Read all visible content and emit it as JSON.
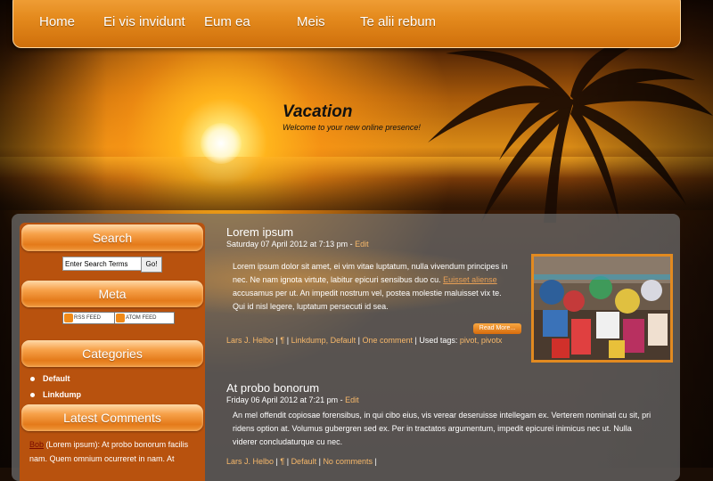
{
  "nav": {
    "items": [
      "Home",
      "Ei vis invidunt",
      "Eum ea",
      "Meis",
      "Te alii rebum"
    ]
  },
  "site": {
    "title": "Vacation",
    "tagline": "Welcome to your new online presence!"
  },
  "sidebar": {
    "search": {
      "heading": "Search",
      "input_value": "Enter Search Terms",
      "button_label": "Go!"
    },
    "meta": {
      "heading": "Meta",
      "rss_label": "RSS FEED",
      "atom_label": "ATOM FEED"
    },
    "categories": {
      "heading": "Categories",
      "items": [
        "Default",
        "Linkdump"
      ]
    },
    "latest_comments": {
      "heading": "Latest Comments",
      "author": "Bob",
      "text": "(Lorem ipsum): At probo bonorum facilis nam. Quem omnium ocurreret in nam. At"
    }
  },
  "posts": [
    {
      "title": "Lorem ipsum",
      "date": "Saturday 07 April 2012 at 7:13 pm",
      "edit_label": "Edit",
      "body_lines": [
        "Lorem ipsum dolor sit amet, ei vim vitae luptatum, nulla vivendum principes in",
        "nec. Ne nam ignota virtute, labitur epicuri sensibus duo cu.",
        "accusamus per ut. An impedit nostrum vel, postea molestie maluisset vix te.",
        "Qui id nisl legere, luptatum persecuti id sea."
      ],
      "inline_link": "Euisset aliense",
      "read_more": "Read More...",
      "author": "Lars J. Helbo",
      "pilcrow": "¶",
      "categories": "Linkdump, Default",
      "comments": "One comment",
      "tags_label": "Used tags:",
      "tags": "pivot, pivotx"
    },
    {
      "title": "At probo bonorum",
      "date": "Friday 06 April 2012 at 7:21 pm",
      "edit_label": "Edit",
      "body_lines": [
        "An mel offendit copiosae forensibus, in qui cibo eius, vis verear deseruisse intellegam ex. Verterem nominati cu sit, pri",
        "ridens option at. Volumus gubergren sed ex. Per in tractatos argumentum, impedit epicurei inimicus nec ut. Nulla",
        "viderer concludaturque cu nec."
      ],
      "author": "Lars J. Helbo",
      "pilcrow": "¶",
      "categories": "Default",
      "comments": "No comments"
    }
  ],
  "colors": {
    "nav_orange": "#e48a1d",
    "sidebar_brown": "#b8520e",
    "link_orange": "#f7b86a"
  }
}
